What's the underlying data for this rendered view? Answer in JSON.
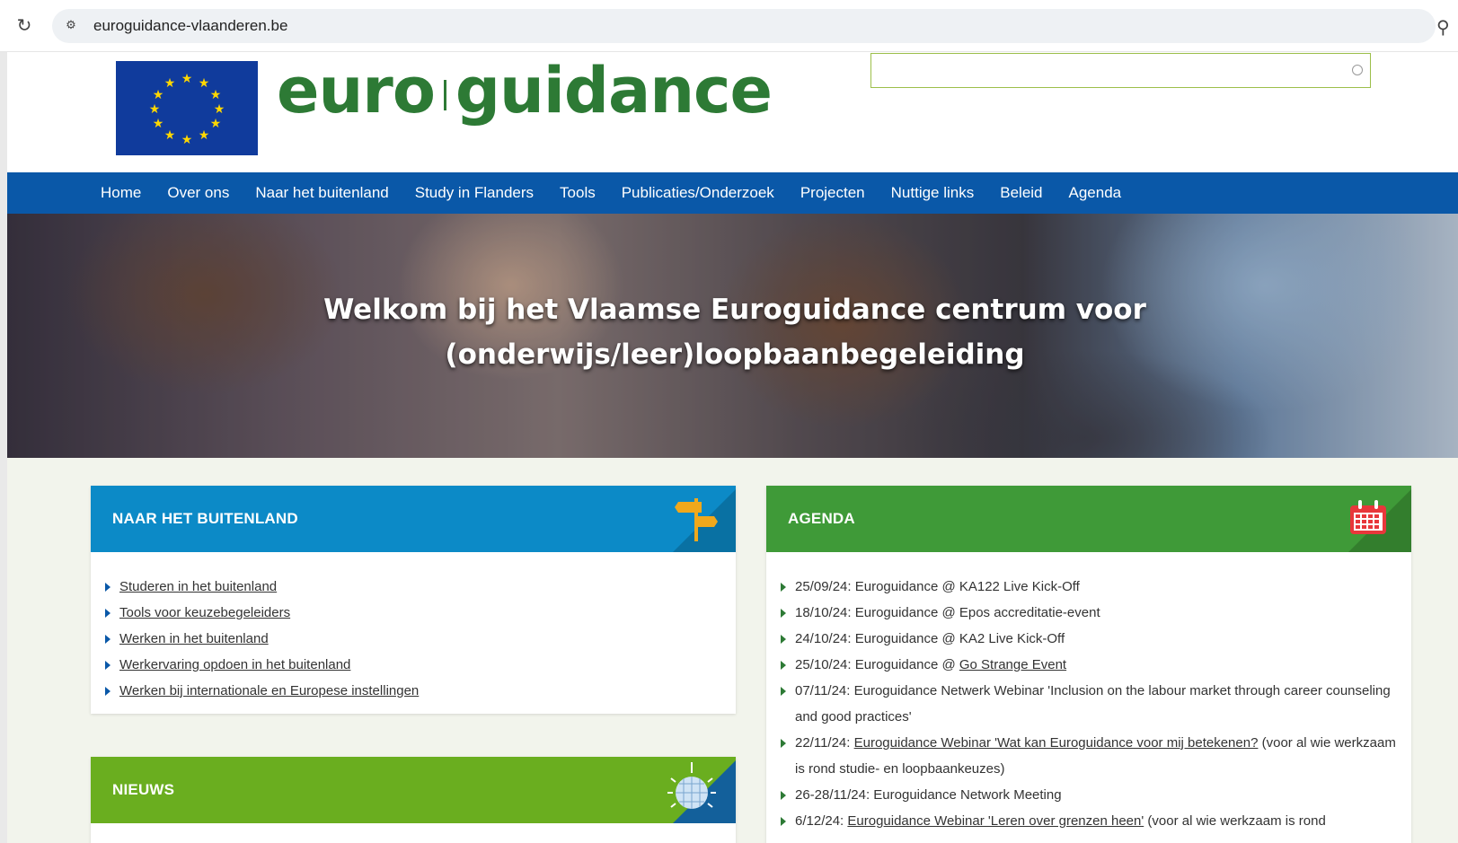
{
  "browser": {
    "url": "euroguidance-vlaanderen.be",
    "reload_icon": "reload-icon",
    "site_info_icon": "site-settings-icon",
    "zoom_icon": "zoom-icon"
  },
  "header": {
    "logo_left": "euro",
    "logo_right": "guidance",
    "search_placeholder": ""
  },
  "nav": {
    "items": [
      "Home",
      "Over ons",
      "Naar het buitenland",
      "Study in Flanders",
      "Tools",
      "Publicaties/Onderzoek",
      "Projecten",
      "Nuttige links",
      "Beleid",
      "Agenda"
    ]
  },
  "hero": {
    "title_line1": "Welkom bij het Vlaamse Euroguidance centrum voor",
    "title_line2": "(onderwijs/leer)loopbaanbegeleiding"
  },
  "panels": {
    "buitenland": {
      "title": "NAAR HET BUITENLAND",
      "icon": "signpost-icon",
      "items": [
        "Studeren in het buitenland",
        "Tools voor keuzebegeleiders",
        "Werken in het buitenland",
        "Werkervaring opdoen in het buitenland",
        "Werken bij internationale en Europese instellingen"
      ]
    },
    "agenda": {
      "title": "AGENDA",
      "icon": "calendar-icon",
      "items": [
        {
          "text": "25/09/24: Euroguidance @ KA122 Live Kick-Off",
          "link": ""
        },
        {
          "text": "18/10/24: Euroguidance @ Epos accreditatie-event",
          "link": ""
        },
        {
          "text": "24/10/24: Euroguidance @ KA2 Live Kick-Off",
          "link": ""
        },
        {
          "text": "25/10/24: Euroguidance @ ",
          "link": "Go Strange Event",
          "after": ""
        },
        {
          "text": "07/11/24: Euroguidance Netwerk Webinar 'Inclusion on the labour market through career counseling and good practices'",
          "link": ""
        },
        {
          "text": "22/11/24: ",
          "link": "Euroguidance Webinar 'Wat kan Euroguidance voor mij betekenen?",
          "after": " (voor al wie werkzaam is rond studie- en loopbaankeuzes)"
        },
        {
          "text": "26-28/11/24: Euroguidance Network Meeting",
          "link": ""
        },
        {
          "text": "6/12/24: ",
          "link": "Euroguidance Webinar 'Leren over grenzen heen'",
          "after": " (voor al wie werkzaam is rond"
        }
      ]
    },
    "nieuws": {
      "title": "NIEUWS",
      "icon": "disco-ball-icon"
    }
  },
  "colors": {
    "nav_blue": "#0a58a8",
    "logo_green": "#2d7a35",
    "buitenland_blue": "#0c8ac7",
    "agenda_green": "#3f9a38",
    "nieuws_green": "#6aae1f"
  }
}
